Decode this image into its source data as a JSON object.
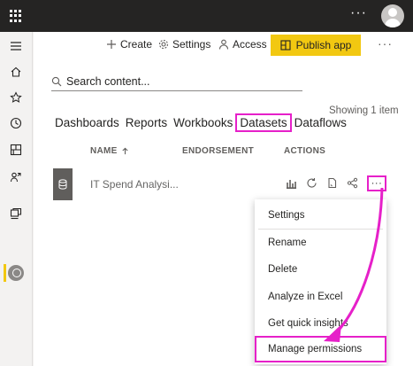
{
  "topbar": {
    "waffle_icon": "waffle-icon",
    "more": "···",
    "avatar_icon": "user-avatar"
  },
  "leftnav": {
    "items": [
      "hamburger-icon",
      "home-icon",
      "favorites-icon",
      "recent-icon",
      "apps-icon",
      "shared-icon",
      "workspaces-icon",
      "workspace-avatar"
    ]
  },
  "actionbar": {
    "create": "Create",
    "settings": "Settings",
    "access": "Access",
    "publish": "Publish app",
    "more": "···"
  },
  "search": {
    "placeholder": "Search content..."
  },
  "tabs": {
    "items": [
      "Dashboards",
      "Reports",
      "Workbooks",
      "Datasets",
      "Dataflows"
    ],
    "active": "Datasets"
  },
  "showing": "Showing 1 item",
  "columns": {
    "name": "NAME",
    "endorsement": "ENDORSEMENT",
    "actions": "ACTIONS"
  },
  "row": {
    "name": "IT Spend Analysi..."
  },
  "menu": {
    "items": [
      "Settings",
      "Rename",
      "Delete",
      "Analyze in Excel",
      "Get quick insights",
      "Manage permissions"
    ]
  },
  "colors": {
    "highlight": "#e620c9",
    "accent": "#f2c811",
    "topbar": "#252423"
  }
}
